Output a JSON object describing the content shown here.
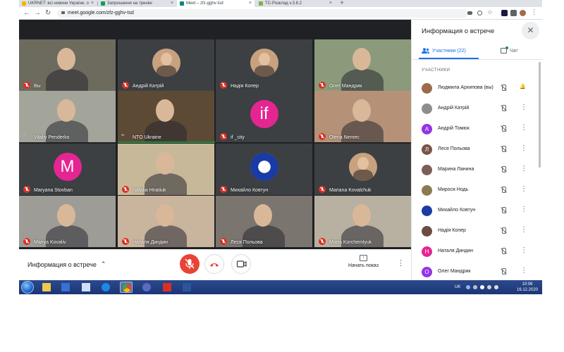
{
  "browser": {
    "tabs": [
      {
        "title": "UKRNET: всі новини України, о",
        "color": "#f4b400",
        "active": false
      },
      {
        "title": "Запрошення на тренінг",
        "color": "#0f9d58",
        "active": false
      },
      {
        "title": "Meet – zfz-gghv-tsd",
        "color": "#00897b",
        "active": true
      },
      {
        "title": "TC-Розклад v.3.8.2",
        "color": "#7cb342",
        "active": false
      }
    ],
    "new_tab_label": "+",
    "url": "meet.google.com/zfz-gghv-tsd",
    "back_icon": "arrow-left-icon",
    "forward_icon": "arrow-right-icon",
    "reload_icon": "reload-icon"
  },
  "tiles": [
    {
      "name": "Вы",
      "muted": true,
      "kind": "video",
      "bg": "#6d6a5e"
    },
    {
      "name": "Андрій Катрій",
      "muted": true,
      "kind": "photo",
      "bg": "#3c4043"
    },
    {
      "name": "Надія Копер",
      "muted": true,
      "kind": "photo",
      "bg": "#3c4043"
    },
    {
      "name": "Олег Мандрик",
      "muted": true,
      "kind": "video",
      "bg": "#8a9a7a"
    },
    {
      "name": "Vitaliy Penderko",
      "muted": false,
      "speaking": true,
      "kind": "video",
      "bg": "#a3a59a"
    },
    {
      "name": "NTO Ukraine",
      "muted": false,
      "speaking": true,
      "kind": "video",
      "bg": "#5d4a35"
    },
    {
      "name": "if _city",
      "muted": true,
      "kind": "letter",
      "letter": "if",
      "avatar_color": "#e52592",
      "bg": "#3c4043"
    },
    {
      "name": "Olena Nemec",
      "muted": true,
      "kind": "video",
      "bg": "#b59277"
    },
    {
      "name": "Maryana Stovban",
      "muted": true,
      "kind": "letter",
      "letter": "M",
      "avatar_color": "#e52592",
      "bg": "#3c4043"
    },
    {
      "name": "Natalia Hnatiuk",
      "muted": true,
      "kind": "video",
      "bg": "#c8b89a"
    },
    {
      "name": "Михайло Ковтун",
      "muted": true,
      "kind": "logo",
      "bg": "#3c4043"
    },
    {
      "name": "Mariana Kovalchuk",
      "muted": true,
      "kind": "photo",
      "bg": "#3c4043"
    },
    {
      "name": "Mariya Kovaliv",
      "muted": true,
      "kind": "video",
      "bg": "#9e9c96"
    },
    {
      "name": "Наталя Диндин",
      "muted": true,
      "kind": "video",
      "bg": "#c9b49e"
    },
    {
      "name": "Леся Польова",
      "muted": true,
      "kind": "video",
      "bg": "#7a756e"
    },
    {
      "name": "Marta Korchemlyuk",
      "muted": true,
      "kind": "video",
      "bg": "#b8b0a0"
    }
  ],
  "controls": {
    "meeting_info_label": "Информация о встрече",
    "present_label": "Начать показ"
  },
  "panel": {
    "title": "Информация о встрече",
    "people_tab_label": "Участники (22)",
    "chat_tab_label": "Чат",
    "participants_heading": "УЧАСТНИКИ",
    "participants": [
      {
        "name": "Людмила Архипова (вы)",
        "avatar": "photo",
        "color": "#9c6b4e",
        "pin": true
      },
      {
        "name": "Андрій Катрій",
        "avatar": "photo",
        "color": "#8d8d8d"
      },
      {
        "name": "Андрій Томюк",
        "avatar": "letter",
        "letter": "А",
        "color": "#9334e6"
      },
      {
        "name": "Леся Польова",
        "avatar": "letter",
        "letter": "Л",
        "color": "#795548"
      },
      {
        "name": "Марина Ланина",
        "avatar": "photo",
        "color": "#7b5e57"
      },
      {
        "name": "Мирося Нодь",
        "avatar": "photo",
        "color": "#8a7b52"
      },
      {
        "name": "Михайло Ковтун",
        "avatar": "photo",
        "color": "#1a3aa6"
      },
      {
        "name": "Надія Копер",
        "avatar": "photo",
        "color": "#6d4c41"
      },
      {
        "name": "Наталя Диндин",
        "avatar": "letter",
        "letter": "Н",
        "color": "#e52592"
      },
      {
        "name": "Олег Мандрик",
        "avatar": "letter",
        "letter": "О",
        "color": "#9334e6"
      }
    ]
  },
  "taskbar": {
    "language": "UK",
    "time": "10:06",
    "date": "16.12.2020"
  }
}
